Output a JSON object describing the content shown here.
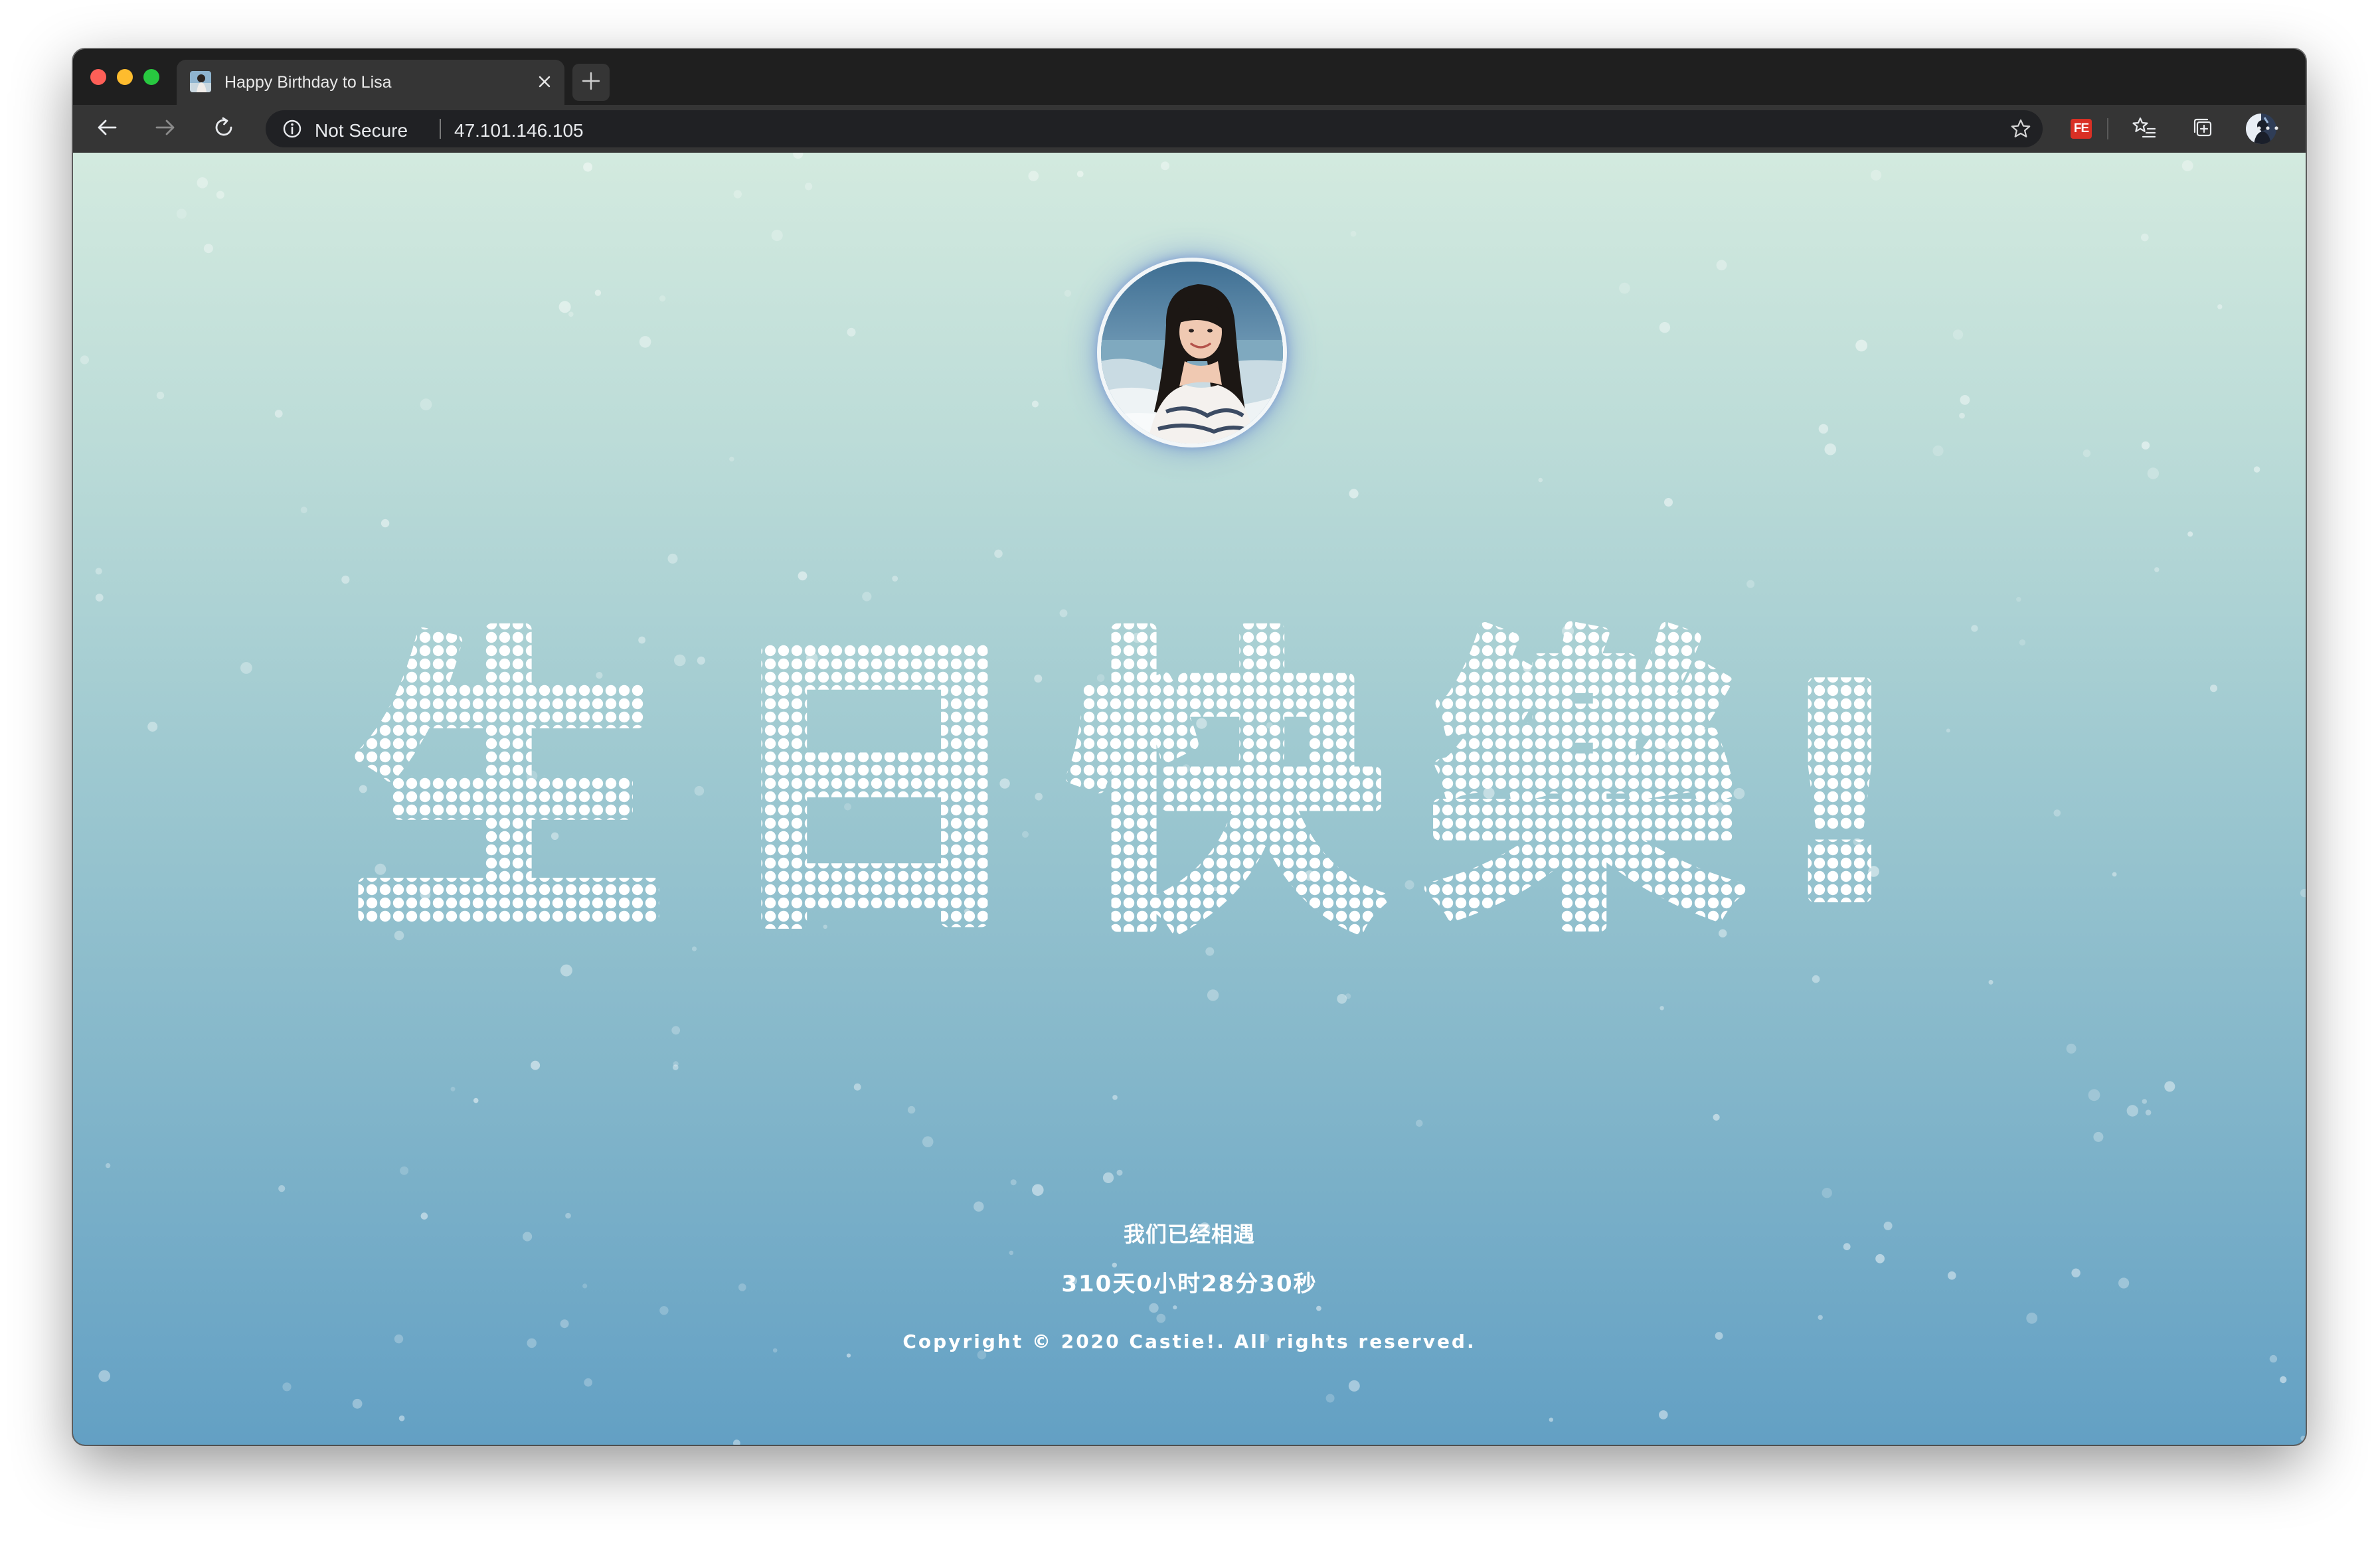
{
  "browser": {
    "tab": {
      "title": "Happy Birthday to Lisa"
    },
    "address_bar": {
      "security_label": "Not Secure",
      "url": "47.101.146.105"
    },
    "extension_badge": "FE"
  },
  "page": {
    "heading": {
      "characters": [
        "生",
        "日",
        "快",
        "樂",
        "!"
      ]
    },
    "footer": {
      "together_text": "我们已经相遇",
      "counter_text": "310天0小时28分30秒",
      "copyright": "Copyright © 2020 Castie!. All rights reserved."
    }
  },
  "colors": {
    "background_top": "#d3eadf",
    "background_bottom": "#63a0c4",
    "dot_color": "#ffffff",
    "avatar_glow": "#7896d2"
  },
  "icons": [
    "close-icon",
    "plus-icon",
    "back-arrow-icon",
    "forward-arrow-icon",
    "reload-icon",
    "info-icon",
    "star-icon",
    "favorites-icon",
    "collections-icon",
    "more-icon"
  ]
}
